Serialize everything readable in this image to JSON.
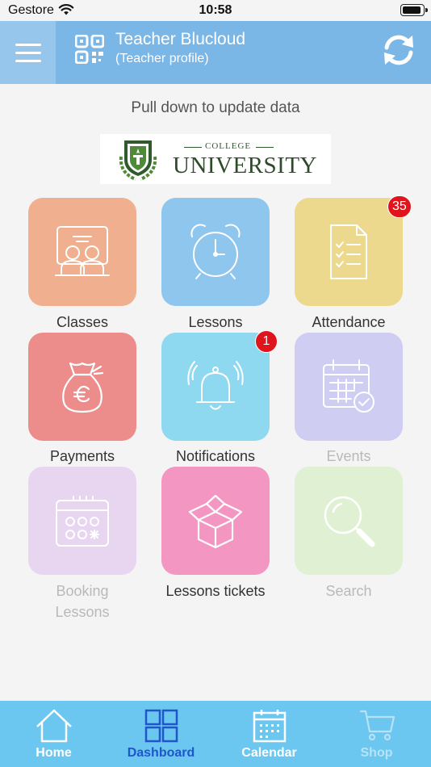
{
  "status_bar": {
    "carrier": "Gestore",
    "time": "10:58"
  },
  "header": {
    "title": "Teacher Blucloud",
    "subtitle": "(Teacher profile)"
  },
  "pull_hint": "Pull down to update data",
  "logo": {
    "college": "COLLEGE",
    "university": "UNIVERSITY"
  },
  "tiles": [
    {
      "label": "Classes",
      "color": "#f0b08f",
      "icon": "classroom-icon",
      "enabled": true
    },
    {
      "label": "Lessons",
      "color": "#8ec6ee",
      "icon": "alarm-clock-icon",
      "enabled": true
    },
    {
      "label": "Attendance",
      "color": "#ecd98e",
      "icon": "checklist-icon",
      "enabled": true,
      "badge": "35"
    },
    {
      "label": "Payments",
      "color": "#ec8d8b",
      "icon": "money-bag-icon",
      "enabled": true
    },
    {
      "label": "Notifications",
      "color": "#8ed9ef",
      "icon": "bell-icon",
      "enabled": true,
      "badge": "1"
    },
    {
      "label": "Events",
      "color": "#cfcdf2",
      "icon": "calendar-check-icon",
      "enabled": false
    },
    {
      "label": "Booking\nLessons",
      "label_line1": "Booking",
      "label_line2": "Lessons",
      "color": "#e8d6f1",
      "icon": "booking-calendar-icon",
      "enabled": false
    },
    {
      "label": "Lessons tickets",
      "color": "#f496c2",
      "icon": "open-box-icon",
      "enabled": true
    },
    {
      "label": "Search",
      "color": "#dff0d3",
      "icon": "magnifier-icon",
      "enabled": false
    }
  ],
  "tabbar": [
    {
      "label": "Home",
      "icon": "home-icon",
      "state": "normal"
    },
    {
      "label": "Dashboard",
      "icon": "dashboard-grid-icon",
      "state": "active"
    },
    {
      "label": "Calendar",
      "icon": "calendar-icon",
      "state": "normal"
    },
    {
      "label": "Shop",
      "icon": "cart-icon",
      "state": "disabled"
    }
  ],
  "colors": {
    "header": "#7ab6e6",
    "tabbar": "#6bc6f0",
    "tab_active": "#1f56c9",
    "badge": "#e0141c"
  }
}
